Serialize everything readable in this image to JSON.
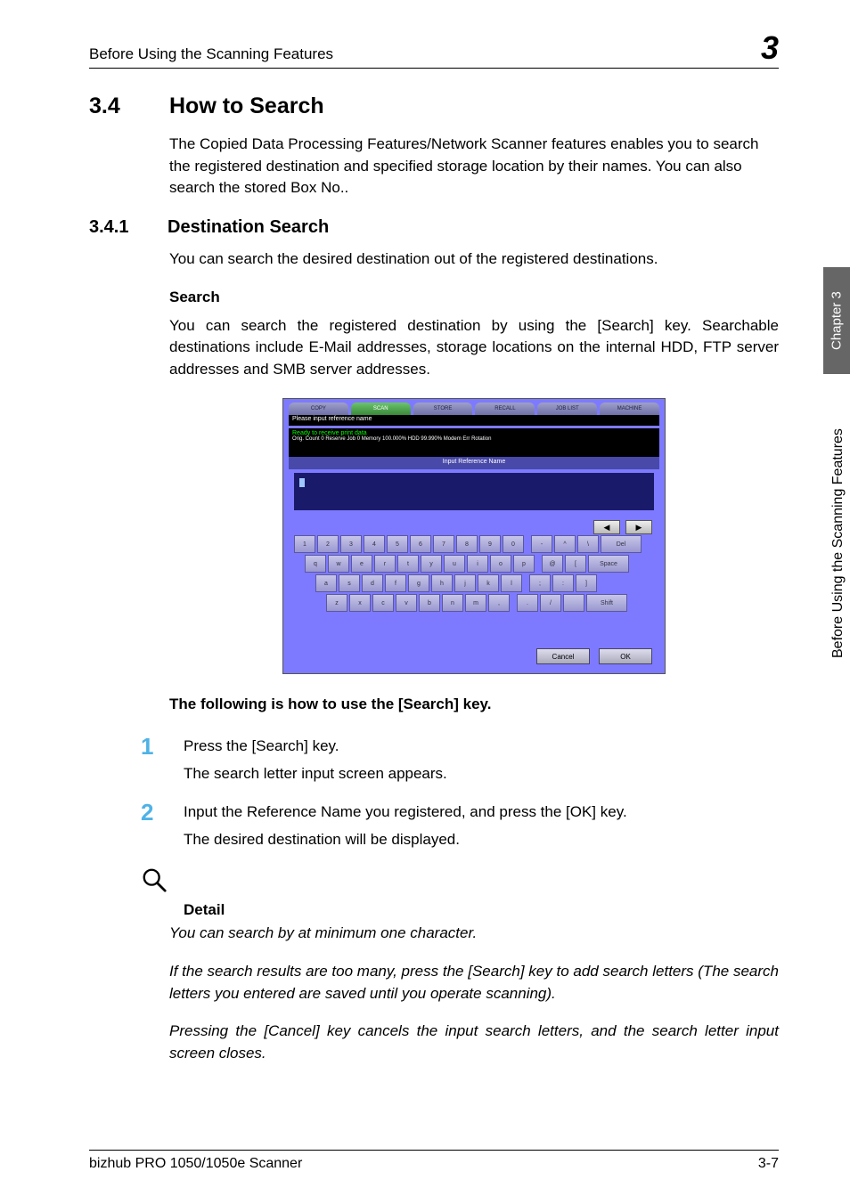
{
  "header": {
    "left": "Before Using the Scanning Features",
    "right": "3"
  },
  "sec": {
    "num": "3.4",
    "title": "How to Search",
    "intro": "The Copied Data Processing Features/Network Scanner features enables you to search the registered destination and specified storage location by their names. You can also search the stored Box No.."
  },
  "sub": {
    "num": "3.4.1",
    "title": "Destination Search",
    "intro": "You can search the desired destination out of the registered destinations."
  },
  "search": {
    "head": "Search",
    "text": "You can search the registered destination by using the [Search] key. Searchable destinations include E-Mail addresses, storage locations on the internal HDD, FTP server addresses and SMB server addresses."
  },
  "screenshot": {
    "tabs": [
      "COPY",
      "SCAN",
      "STORE",
      "RECALL",
      "JOB LIST",
      "MACHINE"
    ],
    "promptbar": "Please input reference name",
    "statusline1": "Ready to receive print data",
    "statusline2": "Orig. Count    0 Reserve Job    0 Memory 100.000% HDD    99.990%  Modem Err  Rotation",
    "inputband": "Input Reference Name",
    "nav_left": "◀",
    "nav_right": "▶",
    "keys_row1": [
      "1",
      "2",
      "3",
      "4",
      "5",
      "6",
      "7",
      "8",
      "9",
      "0",
      "-",
      "^",
      "\\",
      "Del"
    ],
    "keys_row2": [
      "q",
      "w",
      "e",
      "r",
      "t",
      "y",
      "u",
      "i",
      "o",
      "p",
      "@",
      "[",
      "Space"
    ],
    "keys_row3": [
      "a",
      "s",
      "d",
      "f",
      "g",
      "h",
      "j",
      "k",
      "l",
      ";",
      ":",
      "]"
    ],
    "keys_row4": [
      "z",
      "x",
      "c",
      "v",
      "b",
      "n",
      "m",
      ",",
      ".",
      "/",
      "",
      "Shift"
    ],
    "cancel": "Cancel",
    "ok": "OK"
  },
  "following": "The following is how to use the [Search] key.",
  "steps": {
    "s1": {
      "num": "1",
      "text": "Press the [Search] key.",
      "sub": "The search letter input screen appears."
    },
    "s2": {
      "num": "2",
      "text": "Input the Reference Name you registered, and press the [OK] key.",
      "sub": "The desired destination will be displayed."
    }
  },
  "detail": {
    "head": "Detail",
    "p1": "You can search by at minimum one character.",
    "p2": "If the search results are too many, press the [Search] key to add search letters (The search letters you entered are saved until you operate scanning).",
    "p3": "Pressing the [Cancel] key cancels the input search letters, and the search letter input screen closes."
  },
  "side": {
    "chapter": "Chapter 3",
    "label": "Before Using the Scanning Features"
  },
  "footer": {
    "left": "bizhub PRO 1050/1050e Scanner",
    "right": "3-7"
  }
}
